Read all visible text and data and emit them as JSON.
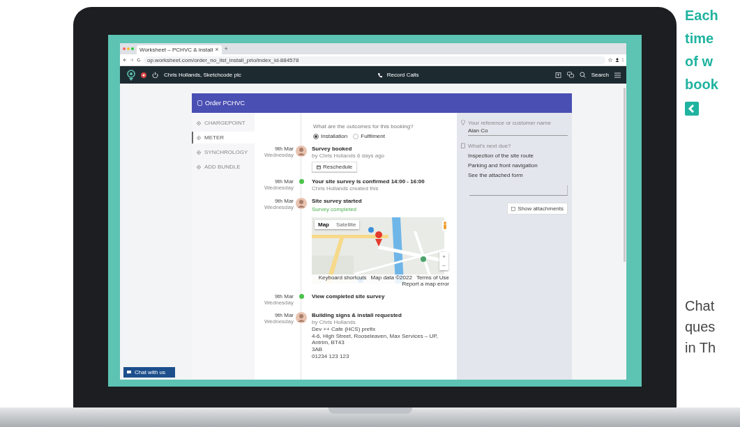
{
  "browser": {
    "tab_title": "Worksheet – PCHVC & install",
    "tab_close": "×",
    "new_tab": "+",
    "url": "op.worksheet.com/order_no_list_install_prio/index_id-884578"
  },
  "app_header": {
    "user": "Chris Hollands, Sketchcode plc",
    "record_calls": "Record Calls",
    "search": "Search"
  },
  "order": {
    "title": "Order PCHVC"
  },
  "nav": [
    {
      "label": "CHARGEPOINT",
      "selected": false
    },
    {
      "label": "METER",
      "selected": true
    },
    {
      "label": "SYNCHROLOGY",
      "selected": false
    },
    {
      "label": "ADD BUNDLE",
      "selected": false
    }
  ],
  "outcome": {
    "question": "What are the outcomes for this booking?",
    "options": [
      {
        "label": "Installation",
        "selected": true
      },
      {
        "label": "Fulfilment",
        "selected": false
      }
    ]
  },
  "timeline": [
    {
      "kind": "avatar",
      "date": "9th Mar",
      "day": "Wednesday",
      "title": "Survey booked",
      "subtitle": "by Chris Hollands 6 days ago",
      "button": "Reschedule"
    },
    {
      "kind": "dot",
      "date": "9th Mar",
      "day": "Wednesday",
      "title": "Your site survey is confirmed 14:00 - 16:00",
      "subtitle": "Chris Hollands created this"
    },
    {
      "kind": "avatar",
      "date": "9th Mar",
      "day": "Wednesday",
      "title": "Site survey started",
      "status": "Survey completed",
      "map": {
        "tabs": [
          {
            "label": "Map",
            "selected": true
          },
          {
            "label": "Satellite",
            "selected": false
          }
        ],
        "zoom_in": "+",
        "zoom_out": "−",
        "footer": [
          "Keyboard shortcuts",
          "Map data ©2022",
          "Terms of Use",
          "Report a map error"
        ]
      }
    },
    {
      "kind": "dot",
      "date": "9th Mar",
      "day": "Wednesday",
      "title": "View completed site survey"
    },
    {
      "kind": "avatar",
      "date": "9th Mar",
      "day": "Wednesday",
      "title": "Building signs & install requested",
      "subtitle": "by Chris Hollands",
      "lines": [
        "Dev ++ Cafe (HCS) prefix",
        "4-6, High Street, Rooseleaven, Max Services – UP, Antrim, BT43",
        "3AB",
        "01234 123 123"
      ]
    }
  ],
  "details": {
    "reference_label": "Your reference or customer name",
    "reference_value": "Alan Co",
    "next_label": "What's next due?",
    "next_items": [
      "Inspection of the site route",
      "Parking and front navigation",
      "See the attached form"
    ],
    "button": "Show attachments"
  },
  "chat_button": "Chat with us",
  "side_text": {
    "heading_lines": [
      "Each",
      "time",
      "of w",
      "book"
    ],
    "body_lines": [
      "Chat",
      "ques",
      "in Th"
    ]
  }
}
